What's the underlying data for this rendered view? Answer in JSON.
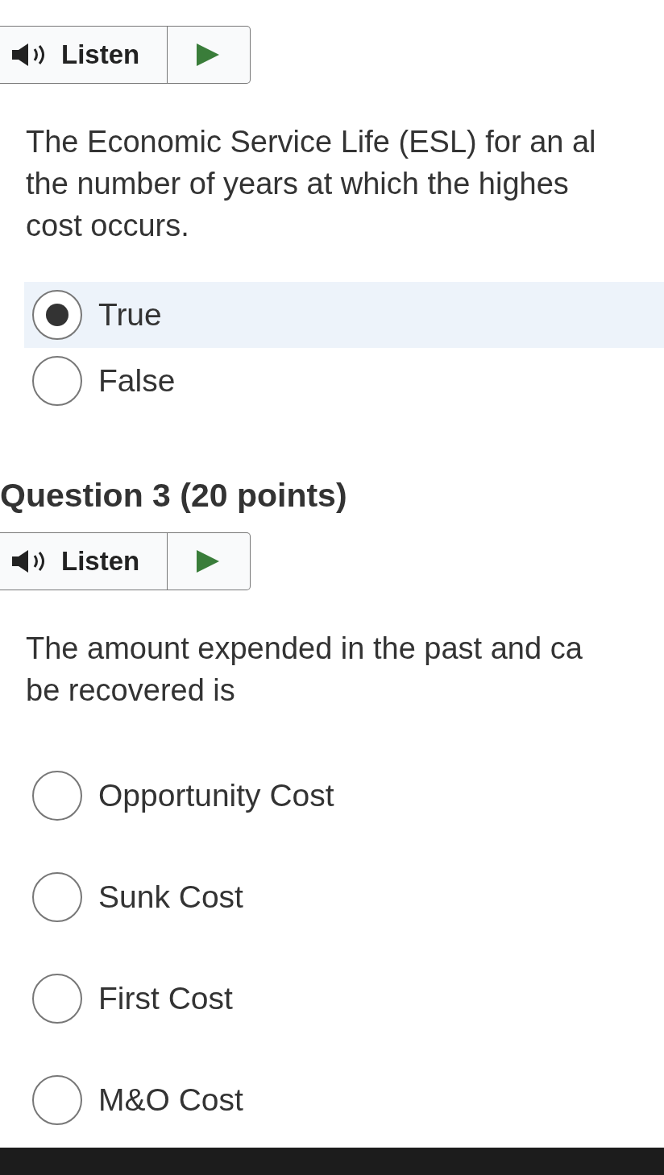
{
  "questions": [
    {
      "listen": {
        "label": "Listen"
      },
      "text_lines": [
        "The Economic Service Life (ESL) for an al",
        "the number of years at which the highes",
        "cost occurs."
      ],
      "options": [
        {
          "label": "True",
          "selected": true
        },
        {
          "label": "False",
          "selected": false
        }
      ]
    },
    {
      "heading": "Question 3 (20 points)",
      "listen": {
        "label": "Listen"
      },
      "text_lines": [
        "The amount expended in the past and ca",
        "be recovered is"
      ],
      "options": [
        {
          "label": "Opportunity Cost",
          "selected": false
        },
        {
          "label": "Sunk Cost",
          "selected": false
        },
        {
          "label": "First Cost",
          "selected": false
        },
        {
          "label": "M&O Cost",
          "selected": false
        }
      ]
    }
  ]
}
